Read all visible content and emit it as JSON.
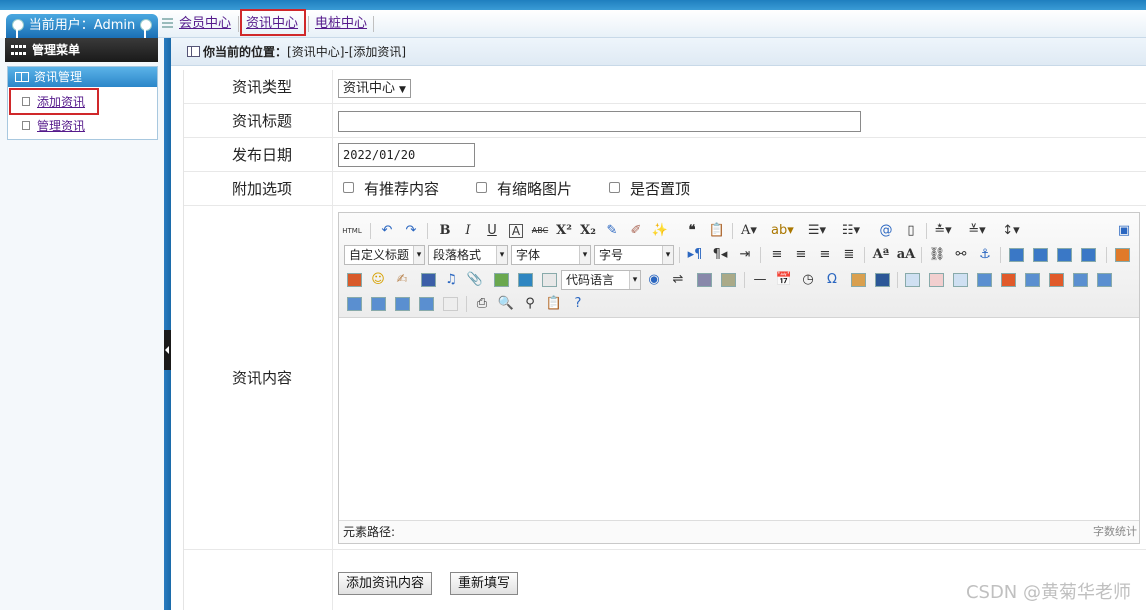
{
  "user_badge": {
    "label": "当前用户：Admin"
  },
  "top_nav": {
    "tabs": [
      {
        "label": "会员中心"
      },
      {
        "label": "资讯中心"
      },
      {
        "label": "电桩中心"
      }
    ],
    "highlight_color": "#d0282a"
  },
  "sidebar": {
    "menu_title": "管理菜单",
    "section_title": "资讯管理",
    "items": [
      {
        "label": "添加资讯"
      },
      {
        "label": "管理资讯"
      }
    ]
  },
  "breadcrumb": {
    "label": "你当前的位置：",
    "path": "[资讯中心]-[添加资讯]"
  },
  "form": {
    "type_label": "资讯类型",
    "type_value": "资讯中心",
    "title_label": "资讯标题",
    "title_value": "",
    "date_label": "发布日期",
    "date_value": "2022/01/20",
    "options_label": "附加选项",
    "options": [
      {
        "label": "有推荐内容",
        "checked": false
      },
      {
        "label": "有缩略图片",
        "checked": false
      },
      {
        "label": "是否置顶",
        "checked": false
      }
    ],
    "content_label": "资讯内容",
    "submit_label": "添加资讯内容",
    "reset_label": "重新填写"
  },
  "editor": {
    "toolbar_combos": {
      "custom_title": "自定义标题",
      "paragraph": "段落格式",
      "font": "字体",
      "font_size": "字号",
      "code_lang": "代码语言"
    },
    "element_path": "元素路径:",
    "word_count": "字数统计"
  },
  "watermark": "CSDN @黄菊华老师",
  "colors": {
    "primary_blue": "#1f7fbf",
    "link_purple": "#551a8b",
    "highlight_red": "#d0282a"
  }
}
